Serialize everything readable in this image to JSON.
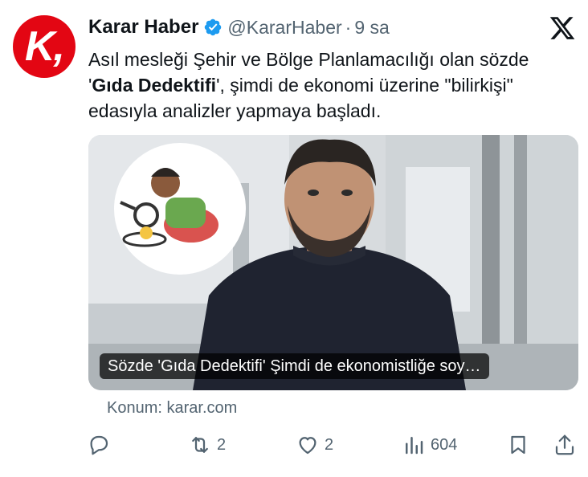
{
  "header": {
    "avatar_letter": "K,",
    "display_name": "Karar Haber",
    "handle": "@KararHaber",
    "separator": "·",
    "time": "9 sa",
    "verified_icon": "verified-badge-icon",
    "platform_icon": "x-logo-icon"
  },
  "tweet": {
    "text_part1": "Asıl mesleği Şehir ve Bölge Planlamacılığı olan sözde '",
    "text_bold": "Gıda Dedektifi",
    "text_part2": "', şimdi de ekonomi üzerine \"bilirkişi\" edasıyla analizler yapmaya başladı."
  },
  "card": {
    "caption": "Sözde 'Gıda Dedektifi' Şimdi de ekonomistliğe soy…",
    "source": "Konum: karar.com"
  },
  "actions": {
    "reply_count": "",
    "retweet_count": "2",
    "like_count": "2",
    "views_count": "604"
  },
  "colors": {
    "brand_red": "#e30613",
    "verified_blue": "#1d9bf0",
    "muted_text": "#536471"
  }
}
